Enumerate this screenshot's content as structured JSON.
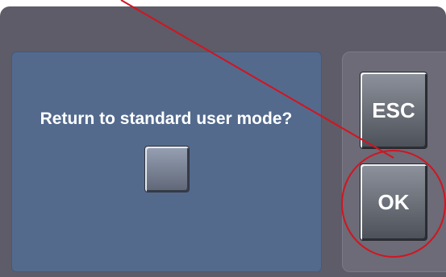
{
  "dialog": {
    "prompt": "Return to standard user mode?",
    "esc_label": "ESC",
    "ok_label": "OK"
  },
  "colors": {
    "frame": "#5d5c68",
    "left_panel": "#536a8d",
    "right_panel": "#6c6b77",
    "annotation": "#d3141f"
  }
}
